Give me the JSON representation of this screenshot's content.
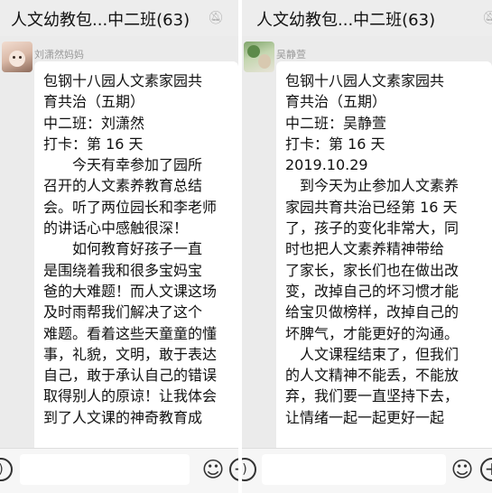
{
  "left": {
    "title": "人文幼教包...中二班(63)",
    "sender": "刘潇然妈妈",
    "lines": [
      "包钢十八园人文素家园共",
      "育共治（五期）",
      "中二班：刘潇然",
      "打卡：第 16 天",
      "　　今天有幸参加了园所",
      "召开的人文素养教育总结",
      "会。听了两位园长和李老师",
      "的讲话心中感触很深！",
      "　　如何教育好孩子一直",
      "是围绕着我和很多宝妈宝",
      "爸的大难题！而人文课这场",
      "及时雨帮我们解决了这个",
      "难题。看着这些天童童的懂",
      "事，礼貌，文明，敢于表达",
      "自己，敢于承认自己的错误",
      "取得别人的原谅！让我体会",
      "到了人文课的神奇教育成"
    ]
  },
  "right": {
    "title": "人文幼教包...中二班(63)",
    "sender": "吴静萱",
    "lines": [
      "包钢十八园人文素家园共",
      "育共治（五期）",
      "中二班：吴静萱",
      "打卡：第 16 天",
      "2019.10.29",
      "　到今天为止参加人文素养",
      "家园共育共治已经第 16 天",
      "了，孩子的变化非常大，同",
      "时也把人文素养精神带给",
      "了家长，家长们也在做出改",
      "变，改掉自己的坏习惯才能",
      "给宝贝做榜样，改掉自己的",
      "坏脾气，才能更好的沟通。",
      "　人文课程结束了，但我们",
      "的人文精神不能丢，不能放",
      "弃，我们要一直坚持下去，",
      "让情绪一起一起更好一起"
    ]
  },
  "icons": {
    "mute": "bell-muted-icon",
    "voice": "voice-icon",
    "emoji": "emoji-icon",
    "plus": "plus-icon"
  }
}
